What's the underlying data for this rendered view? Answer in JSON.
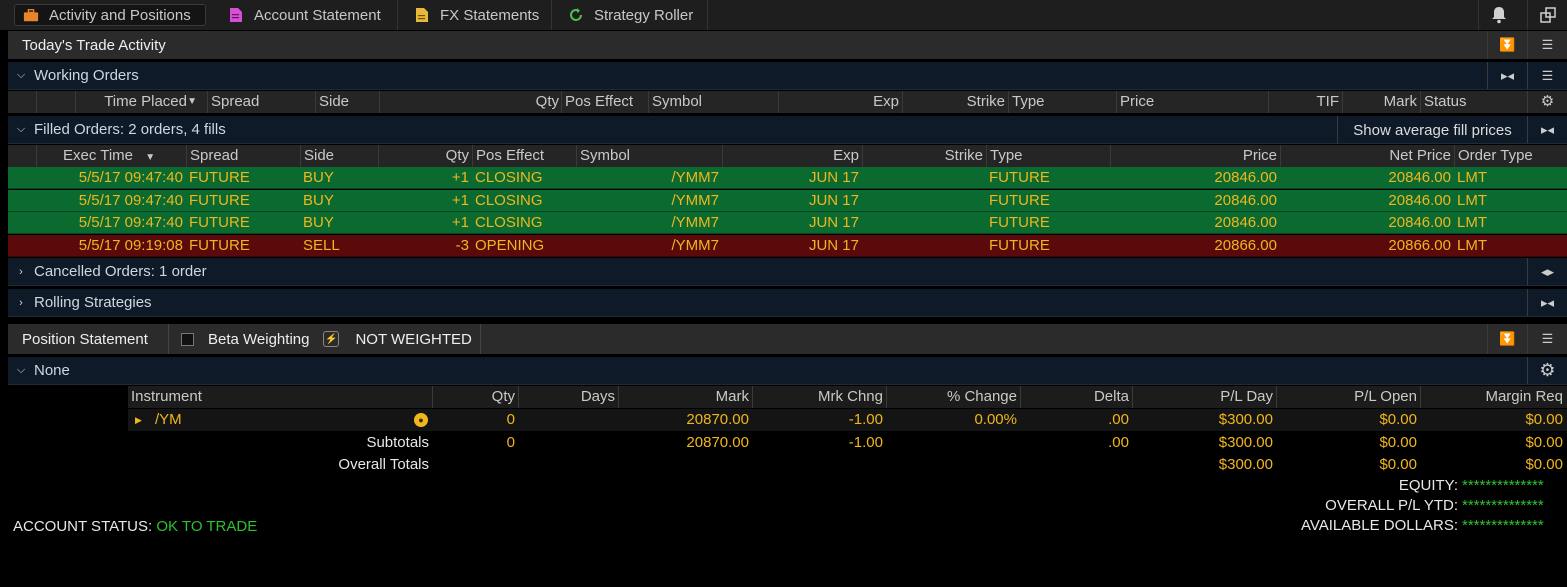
{
  "tabs": [
    {
      "label": "Activity and Positions",
      "icon": "briefcase-icon",
      "color": "#e8852a"
    },
    {
      "label": "Account Statement",
      "icon": "document-icon",
      "color": "#d64fd6"
    },
    {
      "label": "FX Statements",
      "icon": "fx-document-icon",
      "color": "#e8b83a"
    },
    {
      "label": "Strategy Roller",
      "icon": "refresh-icon",
      "color": "#4cc14c"
    }
  ],
  "trade_activity": {
    "title": "Today's Trade Activity"
  },
  "working_orders": {
    "title": "Working Orders",
    "columns": [
      "Time Placed",
      "Spread",
      "Side",
      "Qty",
      "Pos Effect",
      "Symbol",
      "Exp",
      "Strike",
      "Type",
      "Price",
      "TIF",
      "Mark",
      "Status"
    ]
  },
  "filled_orders": {
    "title": "Filled Orders: 2 orders, 4 fills",
    "avg_button": "Show average fill prices",
    "columns": [
      "Exec Time",
      "Spread",
      "Side",
      "Qty",
      "Pos Effect",
      "Symbol",
      "Exp",
      "Strike",
      "Type",
      "Price",
      "Net Price",
      "Order Type"
    ],
    "rows": [
      {
        "time": "5/5/17 09:47:40",
        "spread": "FUTURE",
        "side": "BUY",
        "qty": "+1",
        "pos": "CLOSING",
        "symbol": "/YMM7",
        "exp": "JUN 17",
        "strike": "",
        "type": "FUTURE",
        "price": "20846.00",
        "net": "20846.00",
        "otype": "LMT",
        "color": "#0b6a2f"
      },
      {
        "time": "5/5/17 09:47:40",
        "spread": "FUTURE",
        "side": "BUY",
        "qty": "+1",
        "pos": "CLOSING",
        "symbol": "/YMM7",
        "exp": "JUN 17",
        "strike": "",
        "type": "FUTURE",
        "price": "20846.00",
        "net": "20846.00",
        "otype": "LMT",
        "color": "#0b6a2f"
      },
      {
        "time": "5/5/17 09:47:40",
        "spread": "FUTURE",
        "side": "BUY",
        "qty": "+1",
        "pos": "CLOSING",
        "symbol": "/YMM7",
        "exp": "JUN 17",
        "strike": "",
        "type": "FUTURE",
        "price": "20846.00",
        "net": "20846.00",
        "otype": "LMT",
        "color": "#0b6a2f"
      },
      {
        "time": "5/5/17 09:19:08",
        "spread": "FUTURE",
        "side": "SELL",
        "qty": "-3",
        "pos": "OPENING",
        "symbol": "/YMM7",
        "exp": "JUN 17",
        "strike": "",
        "type": "FUTURE",
        "price": "20866.00",
        "net": "20866.00",
        "otype": "LMT",
        "color": "#5a0a0a"
      }
    ]
  },
  "cancelled_orders": {
    "title": "Cancelled Orders: 1 order"
  },
  "rolling": {
    "title": "Rolling Strategies"
  },
  "position_statement": {
    "title": "Position Statement",
    "beta_label": "Beta Weighting",
    "weight_status": "NOT WEIGHTED",
    "group": "None",
    "columns": [
      "Instrument",
      "Qty",
      "Days",
      "Mark",
      "Mrk Chng",
      "% Change",
      "Delta",
      "P/L Day",
      "P/L Open",
      "Margin Req"
    ],
    "row": {
      "instrument": "/YM",
      "qty": "0",
      "days": "",
      "mark": "20870.00",
      "mrk_chng": "-1.00",
      "pct": "0.00%",
      "delta": ".00",
      "pl_day": "$300.00",
      "pl_open": "$0.00",
      "margin": "$0.00"
    },
    "subtotals": {
      "label": "Subtotals",
      "qty": "0",
      "mark": "20870.00",
      "mrk_chng": "-1.00",
      "delta": ".00",
      "pl_day": "$300.00",
      "pl_open": "$0.00",
      "margin": "$0.00"
    },
    "overall": {
      "label": "Overall Totals",
      "pl_day": "$300.00",
      "pl_open": "$0.00",
      "margin": "$0.00"
    }
  },
  "account": {
    "status_label": "ACCOUNT STATUS:",
    "status_value": "OK TO TRADE",
    "equity_label": "EQUITY:",
    "equity_value": "**************",
    "ytd_label": "OVERALL P/L YTD:",
    "ytd_value": "**************",
    "avail_label": "AVAILABLE DOLLARS:",
    "avail_value": "**************"
  }
}
